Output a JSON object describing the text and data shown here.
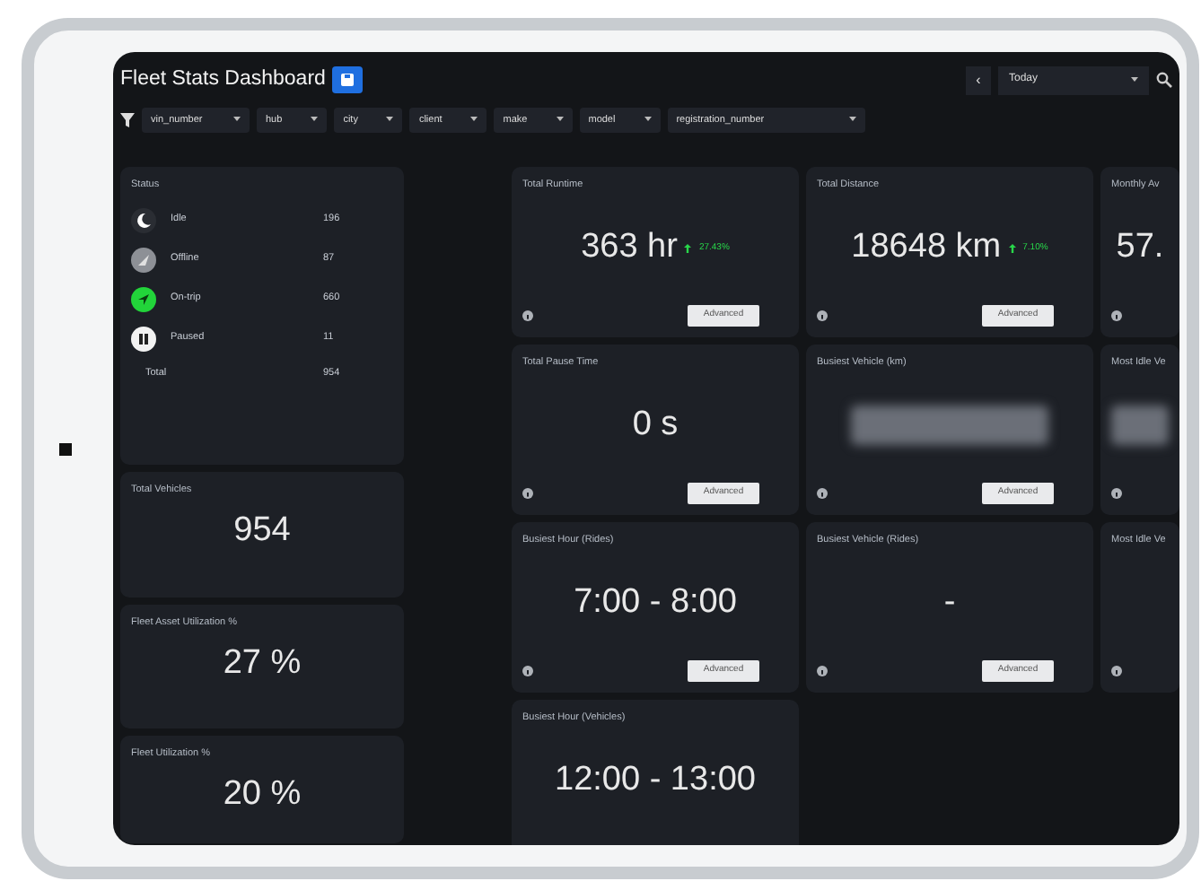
{
  "header": {
    "title": "Fleet Stats Dashboard",
    "nav_prev": "‹",
    "period": "Today"
  },
  "filters": [
    {
      "label": "vin_number"
    },
    {
      "label": "hub"
    },
    {
      "label": "city"
    },
    {
      "label": "client"
    },
    {
      "label": "make"
    },
    {
      "label": "model"
    },
    {
      "label": "registration_number"
    }
  ],
  "status": {
    "title": "Status",
    "items": [
      {
        "kind": "idle",
        "label": "Idle",
        "count": "196"
      },
      {
        "kind": "offline",
        "label": "Offline",
        "count": "87"
      },
      {
        "kind": "ontrip",
        "label": "On-trip",
        "count": "660"
      },
      {
        "kind": "paused",
        "label": "Paused",
        "count": "11"
      }
    ],
    "total_label": "Total",
    "total": "954"
  },
  "left_cards": [
    {
      "title": "Total Vehicles",
      "value": "954"
    },
    {
      "title": "Fleet Asset Utilization %",
      "value": "27 %"
    },
    {
      "title": "Fleet Utilization %",
      "value": "20 %"
    }
  ],
  "cards": [
    {
      "kind": "metric",
      "title": "Total Runtime",
      "value": "363 hr",
      "change": "27.43%",
      "button": "Advanced",
      "info": true
    },
    {
      "kind": "metric",
      "title": "Total Distance",
      "value": "18648 km",
      "change": "7.10%",
      "button": "Advanced",
      "info": true
    },
    {
      "kind": "metric",
      "title": "Monthly Av",
      "value": "57.",
      "info": true
    },
    {
      "kind": "metric",
      "title": "Total Pause Time",
      "value": "0 s",
      "button": "Advanced",
      "info": true
    },
    {
      "kind": "blurred",
      "title": "Busiest Vehicle (km)",
      "button": "Advanced",
      "info": true
    },
    {
      "kind": "blurred",
      "title": "Most Idle Ve",
      "info": true
    },
    {
      "kind": "metric",
      "title": "Busiest Hour (Rides)",
      "value": "7:00 - 8:00",
      "button": "Advanced",
      "info": true
    },
    {
      "kind": "metric",
      "title": "Busiest Vehicle (Rides)",
      "value": "-",
      "button": "Advanced",
      "info": true
    },
    {
      "kind": "metric",
      "title": "Most Idle Ve",
      "info": true
    },
    {
      "kind": "metric",
      "title": "Busiest Hour (Vehicles)",
      "value": "12:00 - 13:00",
      "info": false
    }
  ]
}
